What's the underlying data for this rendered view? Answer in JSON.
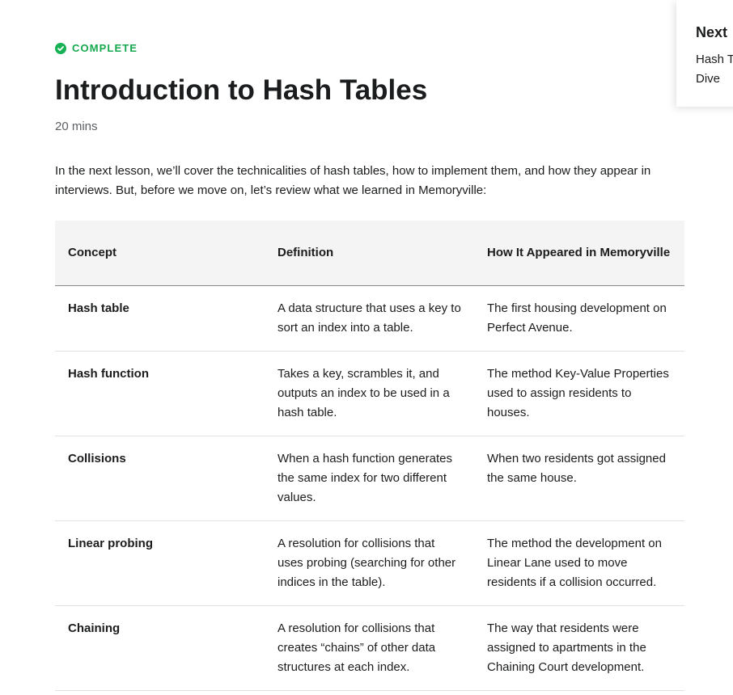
{
  "status": {
    "label": "COMPLETE",
    "icon": "check-circle-icon",
    "color": "#15a84e"
  },
  "lesson": {
    "title": "Introduction to Hash Tables",
    "duration": "20 mins",
    "intro": "In the next lesson, we’ll cover the technicalities of hash tables, how to implement them, and how they appear in interviews. But, before we move on, let’s review what we learned in Memoryville:"
  },
  "table": {
    "headers": [
      "Concept",
      "Definition",
      "How It Appeared in Memoryville"
    ],
    "rows": [
      {
        "concept": "Hash table",
        "definition": "A data structure that uses a key to sort an index into a table.",
        "appearance": "The first housing development on Perfect Avenue."
      },
      {
        "concept": "Hash function",
        "definition": "Takes a key, scrambles it, and outputs an index to be used in a hash table.",
        "appearance": "The method Key-Value Properties used to assign residents to houses."
      },
      {
        "concept": "Collisions",
        "definition": "When a hash function generates the same index for two different values.",
        "appearance": "When two residents got assigned the same house."
      },
      {
        "concept": "Linear probing",
        "definition": "A resolution for collisions that uses probing (searching for other indices in the table).",
        "appearance": "The method the development on Linear Lane used to move residents if a collision occurred."
      },
      {
        "concept": "Chaining",
        "definition": "A resolution for collisions that creates “chains” of other data structures at each index.",
        "appearance": "The way that residents were assigned to apartments in the Chaining Court development."
      }
    ]
  },
  "next": {
    "heading": "Next",
    "lesson_title": "Hash T\nDive"
  }
}
